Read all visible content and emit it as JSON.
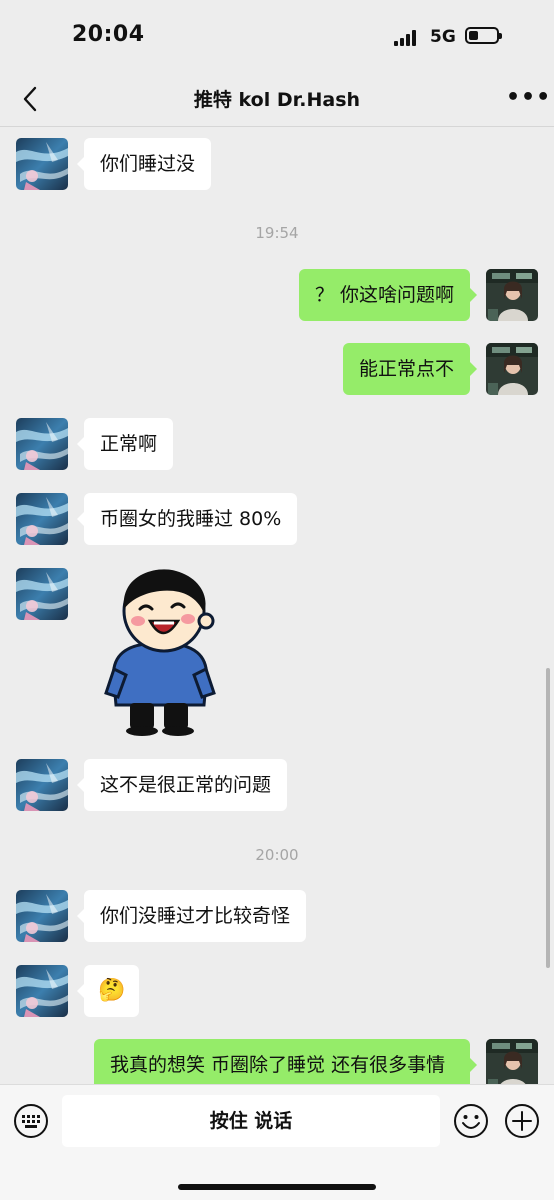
{
  "status": {
    "time": "20:04",
    "network": "5G"
  },
  "header": {
    "title": "推特 kol Dr.Hash"
  },
  "messages": {
    "m1": "你们睡过没",
    "t1": "19:54",
    "m2": "？ 你这啥问题啊",
    "m3": "能正常点不",
    "m4": "正常啊",
    "m5": "币圈女的我睡过 80%",
    "m6_sticker": "laughing-boy-sticker",
    "m7": "这不是很正常的问题",
    "t2": "20:00",
    "m8": "你们没睡过才比较奇怪",
    "m9_emoji": "🤔",
    "m10": "我真的想笑 币圈除了睡觉 还有很多事情"
  },
  "input": {
    "hold_to_talk": "按住 说话"
  },
  "colors": {
    "outgoing_bubble": "#95ec69",
    "incoming_bubble": "#ffffff",
    "background": "#ededed"
  }
}
